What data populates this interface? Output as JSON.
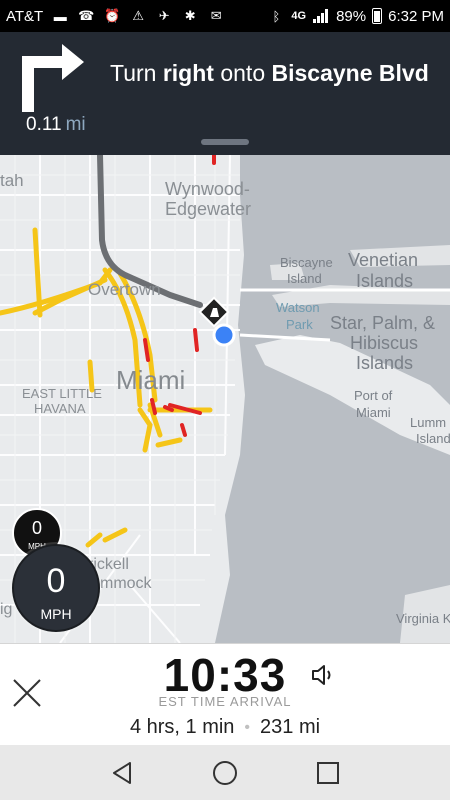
{
  "status_bar": {
    "carrier": "AT&T",
    "battery": "89%",
    "time": "6:32 PM",
    "network": "4G"
  },
  "navigation": {
    "distance_value": "0.11",
    "distance_unit": "mi",
    "instruction_prefix": "Turn",
    "instruction_direction": "right",
    "instruction_middle": "onto",
    "instruction_street": "Biscayne Blvd"
  },
  "map_labels": {
    "tah": "tah",
    "wynwood": "Wynwood-",
    "edgewater": "Edgewater",
    "overtown": "Overtown",
    "miami": "Miami",
    "east_little": "EAST LITTLE",
    "havana": "HAVANA",
    "biscayne": "Biscayne",
    "island": "Island",
    "venetian": "Venetian",
    "islands": "Islands",
    "watson": "Watson",
    "park": "Park",
    "star_palm": "Star, Palm, &",
    "hibiscus": "Hibiscus",
    "islands2": "Islands",
    "port_of": "Port of",
    "port_miami": "Miami",
    "lummus": "Lumm",
    "lummus_island": "Island",
    "brickell": "rickell",
    "hammock": "mmock",
    "virginia": "Virginia K",
    "ig": "ig"
  },
  "speed": {
    "limit_value": "0",
    "limit_unit": "MPH",
    "current_value": "0",
    "current_unit": "MPH"
  },
  "trip": {
    "arrival_time": "10:33",
    "arrival_label": "EST TIME ARRIVAL",
    "duration": "4 hrs, 1 min",
    "distance": "231 mi"
  },
  "icons": {
    "turn": "turn-right-arrow",
    "close": "close-x",
    "volume": "speaker",
    "back": "triangle-back",
    "home": "circle-home",
    "recents": "square-recents"
  },
  "colors": {
    "header_bg": "#242a33",
    "route": "#6c6f73",
    "position": "#3b82f6",
    "traffic_yellow": "#f5c518",
    "traffic_red": "#e02424",
    "water": "#b9bec4"
  }
}
